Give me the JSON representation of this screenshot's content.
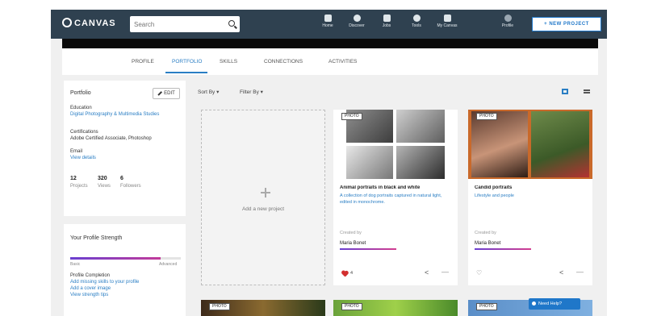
{
  "app": {
    "logo": "CANVAS"
  },
  "search": {
    "placeholder": "Search",
    "value": ""
  },
  "nav": {
    "items": [
      {
        "label": "Home",
        "icon": "home-icon"
      },
      {
        "label": "Discover",
        "icon": "compass-icon"
      },
      {
        "label": "Jobs",
        "icon": "briefcase-icon"
      },
      {
        "label": "Tools",
        "icon": "tools-icon"
      },
      {
        "label": "My Canvas",
        "icon": "user-icon"
      },
      {
        "label": "Profile",
        "icon": "avatar-icon"
      }
    ],
    "create_label": "+ NEW PROJECT"
  },
  "tabs": [
    "PROFILE",
    "PORTFOLIO",
    "SKILLS",
    "CONNECTIONS",
    "ACTIVITIES"
  ],
  "active_tab": "PORTFOLIO",
  "profile": {
    "heading": "Portfolio",
    "edit_label": "EDIT",
    "education_label": "Education",
    "education_value": "Digital Photography & Multimedia Studies",
    "certs_label": "Certifications",
    "certs_value": "Adobe Certified Associate, Photoshop",
    "email_label": "Email",
    "email_value": "View details",
    "stats": [
      {
        "num": "12",
        "label": "Projects"
      },
      {
        "num": "320",
        "label": "Views"
      },
      {
        "num": "6",
        "label": "Followers"
      }
    ]
  },
  "profile_strength": {
    "title": "Your Profile Strength",
    "level_left": "Basic",
    "level_right": "Advanced",
    "progress": 0.82,
    "links": [
      "Profile Completion",
      "Add missing skills to your profile",
      "Add a cover image",
      "View strength tips"
    ]
  },
  "toolbar": {
    "sort_label": "Sort By",
    "filter_label": "Filter By"
  },
  "new_project": {
    "label": "Add a new project"
  },
  "projects": [
    {
      "badge": "PHOTO",
      "title": "Animal portraits in black and white",
      "subtitle": "A collection of dog portraits captured in natural light, edited in monochrome.",
      "owner_label": "Created by",
      "owner": "Maria Bonet",
      "likes": "4",
      "liked": true
    },
    {
      "badge": "PHOTO",
      "title": "Candid portraits",
      "subtitle": "Lifestyle and people",
      "owner_label": "Created by",
      "owner": "Maria Bonet",
      "likes": "",
      "liked": false
    }
  ],
  "bottom_badges": [
    "PHOTO",
    "PHOTO",
    "PHOTO"
  ],
  "help": {
    "label": "Need Help?"
  },
  "colors": {
    "nav": "#2f4150",
    "accent": "#2a7ec4",
    "gradient_start": "#6a3fd0",
    "gradient_end": "#d33d8f"
  }
}
